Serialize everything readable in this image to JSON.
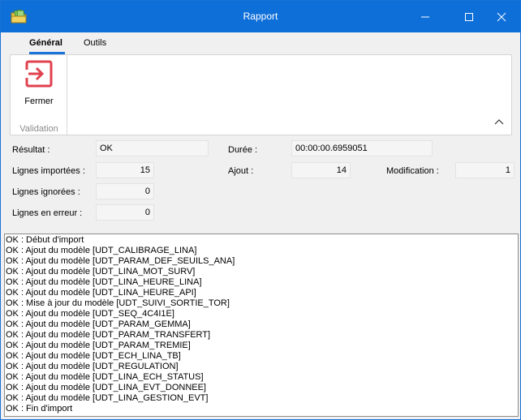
{
  "window": {
    "title": "Rapport",
    "controls": {
      "minimize": "minimize",
      "maximize": "maximize",
      "close": "close"
    }
  },
  "tabs": [
    {
      "label": "Général",
      "active": true
    },
    {
      "label": "Outils",
      "active": false
    }
  ],
  "ribbon": {
    "group_label": "Validation",
    "fermer_label": "Fermer",
    "fermer_icon": "exit-icon",
    "accent": "#e0414f"
  },
  "form": {
    "resultat_label": "Résultat :",
    "resultat_value": "OK",
    "duree_label": "Durée :",
    "duree_value": "00:00:00.6959051",
    "lignes_importees_label": "Lignes importées :",
    "lignes_importees_value": "15",
    "ajout_label": "Ajout :",
    "ajout_value": "14",
    "modification_label": "Modification :",
    "modification_value": "1",
    "lignes_ignorees_label": "Lignes ignorées :",
    "lignes_ignorees_value": "0",
    "lignes_erreur_label": "Lignes en erreur :",
    "lignes_erreur_value": "0"
  },
  "log": [
    "OK : Début d'import",
    "OK : Ajout du modèle [UDT_CALIBRAGE_LINA]",
    "OK : Ajout du modèle [UDT_PARAM_DEF_SEUILS_ANA]",
    "OK : Ajout du modèle [UDT_LINA_MOT_SURV]",
    "OK : Ajout du modèle [UDT_LINA_HEURE_LINA]",
    "OK : Ajout du modèle [UDT_LINA_HEURE_API]",
    "OK : Mise à jour du modèle [UDT_SUIVI_SORTIE_TOR]",
    "OK : Ajout du modèle [UDT_SEQ_4C4I1E]",
    "OK : Ajout du modèle [UDT_PARAM_GEMMA]",
    "OK : Ajout du modèle [UDT_PARAM_TRANSFERT]",
    "OK : Ajout du modèle [UDT_PARAM_TREMIE]",
    "OK : Ajout du modèle [UDT_ECH_LINA_TB]",
    "OK : Ajout du modèle [UDT_REGULATION]",
    "OK : Ajout du modèle [UDT_LINA_ECH_STATUS]",
    "OK : Ajout du modèle [UDT_LINA_EVT_DONNEE]",
    "OK : Ajout du modèle [UDT_LINA_GESTION_EVT]",
    "OK : Fin d'import"
  ]
}
